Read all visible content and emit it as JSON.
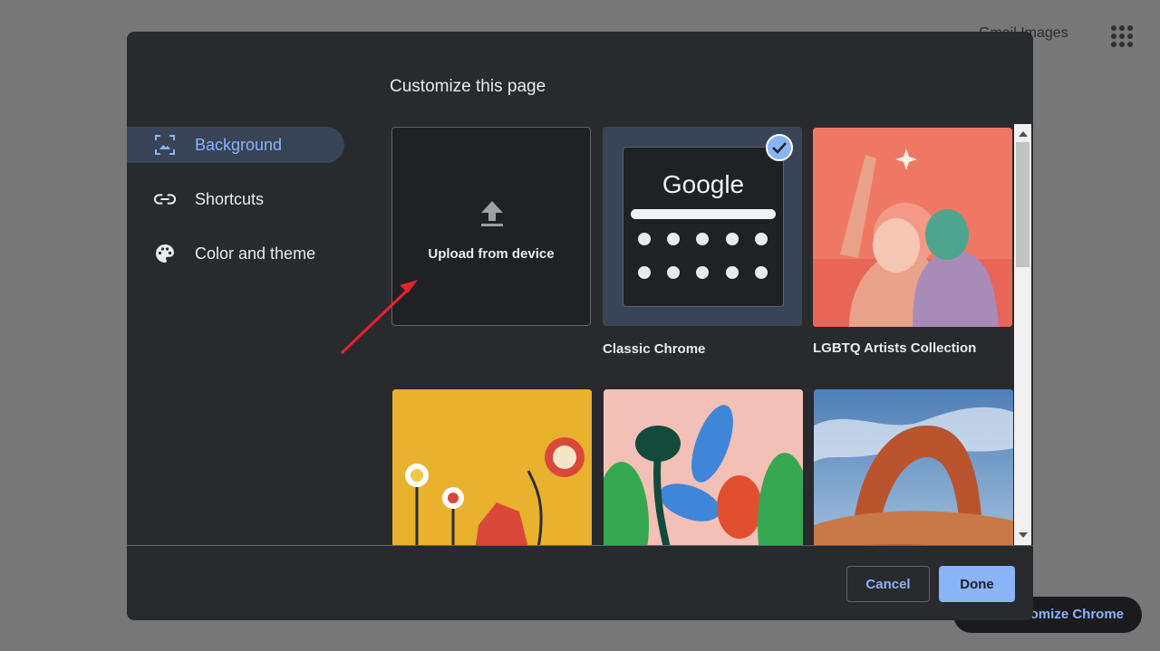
{
  "background_page": {
    "top_link": "Gmail Images",
    "customize_button": "Customize Chrome"
  },
  "dialog": {
    "title": "Customize this page",
    "nav": [
      {
        "label": "Background",
        "icon": "background-icon",
        "selected": true
      },
      {
        "label": "Shortcuts",
        "icon": "link-icon",
        "selected": false
      },
      {
        "label": "Color and theme",
        "icon": "palette-icon",
        "selected": false
      }
    ],
    "tiles": {
      "upload": {
        "label": "Upload from device",
        "icon": "upload-icon"
      },
      "classic": {
        "label": "Classic Chrome",
        "logo_text": "Google",
        "selected": true
      },
      "lgbtq": {
        "label": "LGBTQ Artists Collection"
      }
    },
    "buttons": {
      "cancel": "Cancel",
      "done": "Done"
    }
  },
  "colors": {
    "dialog_bg": "#292a2d",
    "accent": "#8ab4f8",
    "selected_nav_bg": "#394457",
    "annotation_arrow": "#e8202a"
  }
}
